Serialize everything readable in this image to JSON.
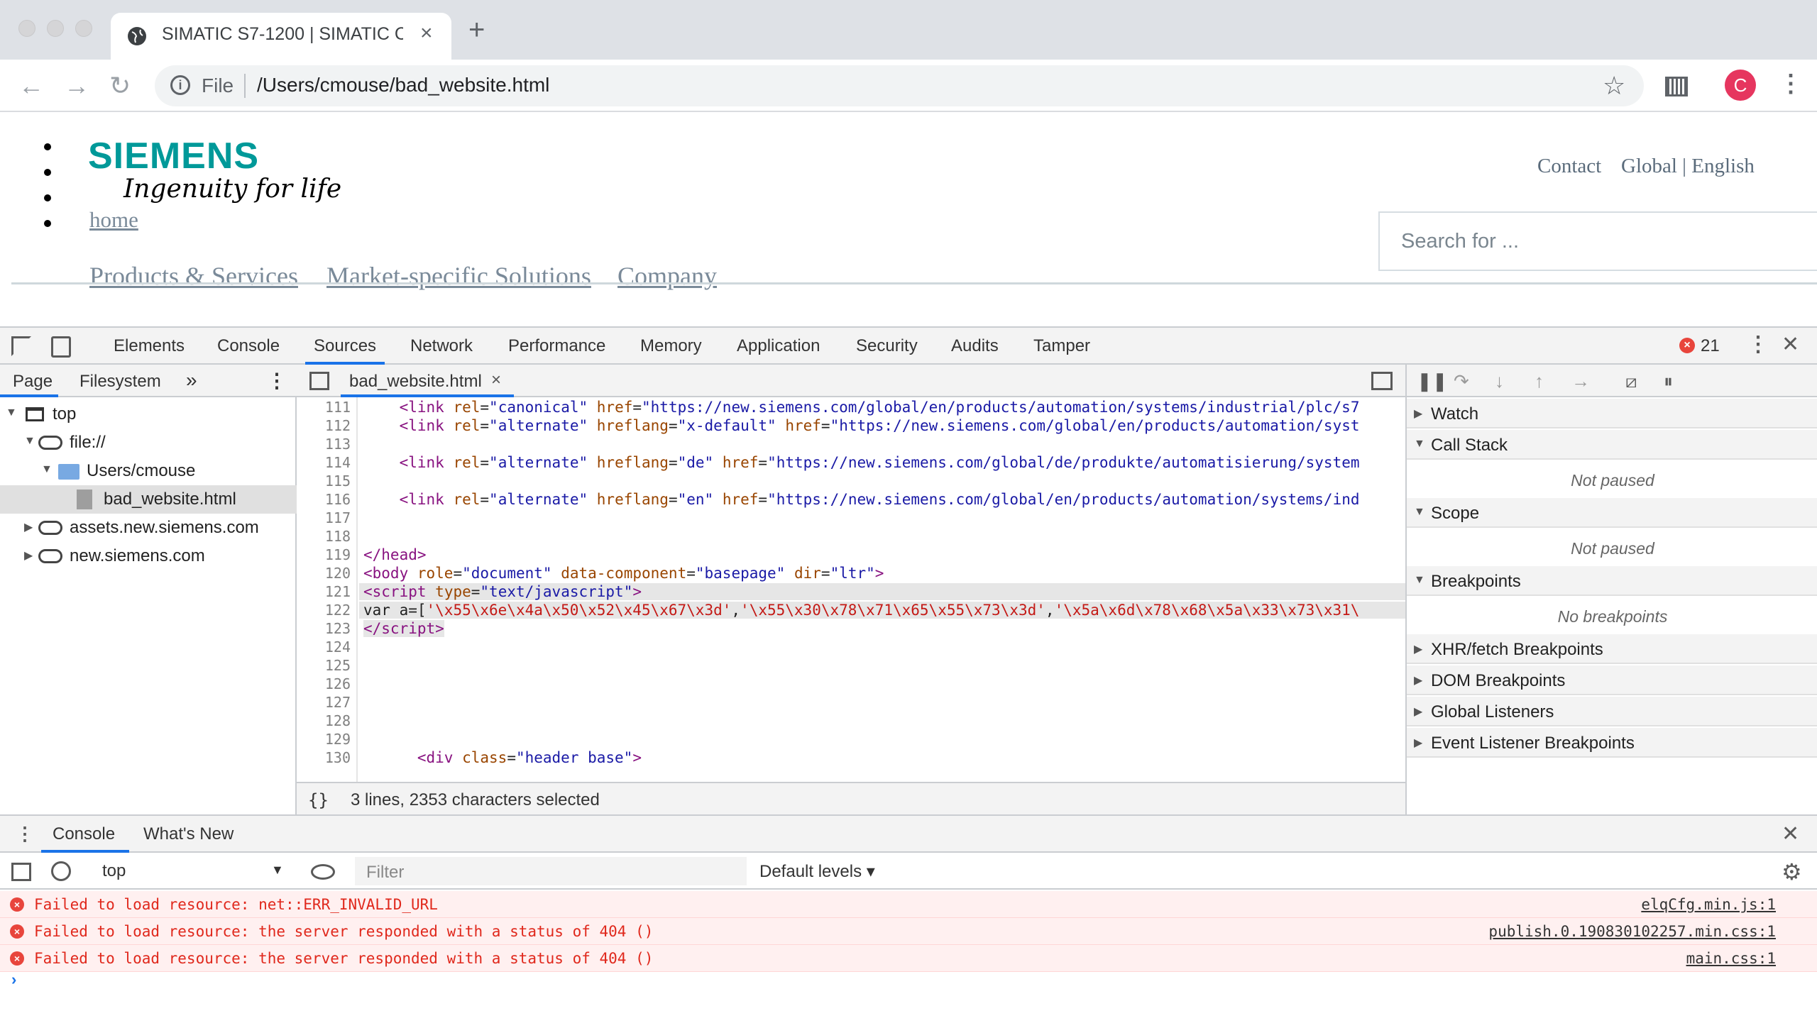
{
  "browser": {
    "tab_title": "SIMATIC S7-1200 | SIMATIC Co",
    "tab_close": "×",
    "new_tab": "+",
    "back": "←",
    "forward": "→",
    "reload": "↻",
    "scheme_label": "File",
    "url": "/Users/cmouse/bad_website.html",
    "star": "☆",
    "avatar_letter": "C",
    "menu": "⋮"
  },
  "page": {
    "logo": "SIEMENS",
    "tagline": "Ingenuity for life",
    "home_link": "home",
    "nav": [
      "Products & Services",
      "Market-specific Solutions",
      "Company"
    ],
    "contact": "Contact",
    "global": "Global | English",
    "search_placeholder": "Search for ..."
  },
  "devtools": {
    "tabs": [
      "Elements",
      "Console",
      "Sources",
      "Network",
      "Performance",
      "Memory",
      "Application",
      "Security",
      "Audits",
      "Tamper"
    ],
    "active_tab": "Sources",
    "error_count": "21",
    "navigator": {
      "tabs": [
        "Page",
        "Filesystem"
      ],
      "more": "»",
      "tree": [
        {
          "label": "top",
          "kind": "frame"
        },
        {
          "label": "file://",
          "kind": "cloud"
        },
        {
          "label": "Users/cmouse",
          "kind": "folder"
        },
        {
          "label": "bad_website.html",
          "kind": "file",
          "selected": true
        },
        {
          "label": "assets.new.siemens.com",
          "kind": "cloud"
        },
        {
          "label": "new.siemens.com",
          "kind": "cloud"
        }
      ]
    },
    "editor": {
      "file_tab": "bad_website.html",
      "close": "×",
      "line_numbers": [
        "111",
        "112",
        "113",
        "114",
        "115",
        "116",
        "117",
        "118",
        "119",
        "120",
        "121",
        "122",
        "123",
        "124",
        "125",
        "126",
        "127",
        "128",
        "129",
        "130"
      ],
      "status_braces": "{}",
      "status_text": "3 lines, 2353 characters selected"
    },
    "debugger": {
      "sections": [
        {
          "title": "Watch",
          "expanded": false
        },
        {
          "title": "Call Stack",
          "expanded": true,
          "body": "Not paused"
        },
        {
          "title": "Scope",
          "expanded": true,
          "body": "Not paused"
        },
        {
          "title": "Breakpoints",
          "expanded": true,
          "body": "No breakpoints"
        },
        {
          "title": "XHR/fetch Breakpoints",
          "expanded": false
        },
        {
          "title": "DOM Breakpoints",
          "expanded": false
        },
        {
          "title": "Global Listeners",
          "expanded": false
        },
        {
          "title": "Event Listener Breakpoints",
          "expanded": false
        }
      ]
    },
    "drawer": {
      "tabs": [
        "Console",
        "What's New"
      ],
      "context": "top",
      "filter_placeholder": "Filter",
      "levels": "Default levels ▾",
      "messages": [
        {
          "text": "Failed to load resource: net::ERR_INVALID_URL",
          "source": "elqCfg.min.js:1"
        },
        {
          "text": "Failed to load resource: the server responded with a status of 404 ()",
          "source": "publish.0.190830102257.min.css:1"
        },
        {
          "text": "Failed to load resource: the server responded with a status of 404 ()",
          "source": "main.css:1"
        }
      ],
      "prompt": "›"
    }
  },
  "colors": {
    "siemens_teal": "#009999",
    "devtools_accent": "#1a73e8",
    "error_red": "#e0281c",
    "error_bg": "#fff0f0",
    "avatar": "#e6365f"
  }
}
